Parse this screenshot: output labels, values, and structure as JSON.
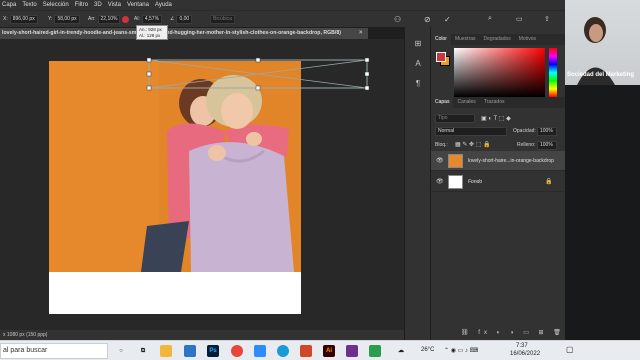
{
  "menu": [
    "Capa",
    "Texto",
    "Selección",
    "Filtro",
    "3D",
    "Vista",
    "Ventana",
    "Ayuda"
  ],
  "options": {
    "x_label": "X:",
    "x_value": "896,00 px",
    "y_label": "Y:",
    "y_value": "58,00 px",
    "w_label": "An:",
    "w_value": "22,10%",
    "h_label": "Al:",
    "h_value": "4,57%",
    "angle_value": "0,00",
    "interp_label": "Bicúbica"
  },
  "tooltip": {
    "line1": "An.: 928 px",
    "line2": "Al.: 128 px"
  },
  "document_tab": "lovely-short-haired-girl-in-trendy-hoodie-and-jeans-smiling-...yes-and-hugging-her-mother-in-stylish-clothes-on-orange-backdrop, RGB/8)",
  "status": "x 1080 px (150 ppp)",
  "color_panel": {
    "tabs": [
      "Color",
      "Muestras",
      "Degradados",
      "Motivos"
    ],
    "fg": "#d13438",
    "bg": "#e89d2b"
  },
  "layers_panel": {
    "tabs": [
      "Capas",
      "Canales",
      "Trazados"
    ],
    "search_placeholder": "Tipo",
    "blend_mode": "Normal",
    "opacity_label": "Opacidad:",
    "opacity_value": "100%",
    "lock_label": "Bloq.:",
    "fill_label": "Relleno:",
    "fill_value": "100%",
    "layers": [
      {
        "name": "lovely-short-haire...in-orange-backdrop",
        "selected": true
      },
      {
        "name": "Fondo",
        "selected": false
      }
    ]
  },
  "webcam": {
    "name": "Sociedad del Marketing"
  },
  "taskbar": {
    "search_placeholder": "al para buscar",
    "weather": "26°C",
    "time": "7:37",
    "date": "16/06/2022"
  },
  "colors": {
    "photo_bg": "#e5892c",
    "accent": "#d13438"
  }
}
